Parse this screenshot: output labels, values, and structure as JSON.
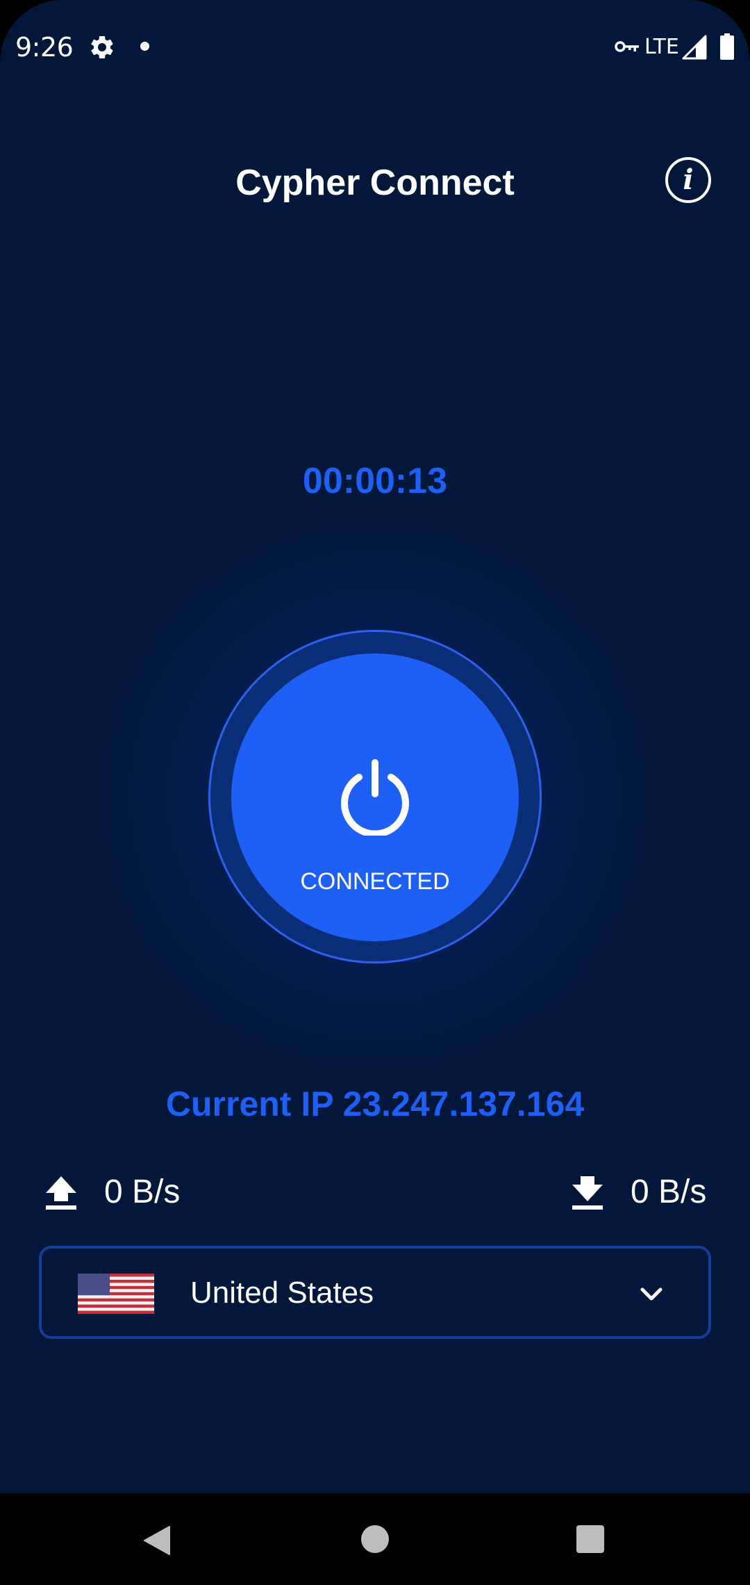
{
  "status_bar": {
    "time": "9:26",
    "network": "LTE",
    "icons": [
      "gear-icon",
      "notification-dot",
      "vpn-key-icon",
      "signal-icon",
      "battery-icon"
    ]
  },
  "header": {
    "title": "Cypher Connect",
    "info_icon": "i"
  },
  "connection": {
    "timer": "00:00:13",
    "status": "CONNECTED",
    "current_ip": "Current IP 23.247.137.164"
  },
  "speeds": {
    "upload": "0 B/s",
    "download": "0 B/s"
  },
  "location": {
    "country": "United States",
    "flag": "us-flag"
  },
  "nav": {
    "buttons": [
      "back",
      "home",
      "recents"
    ]
  },
  "colors": {
    "background": "#02173a",
    "accent": "#1e5ff5",
    "ring": "#0b2e78",
    "border": "#163e99"
  }
}
